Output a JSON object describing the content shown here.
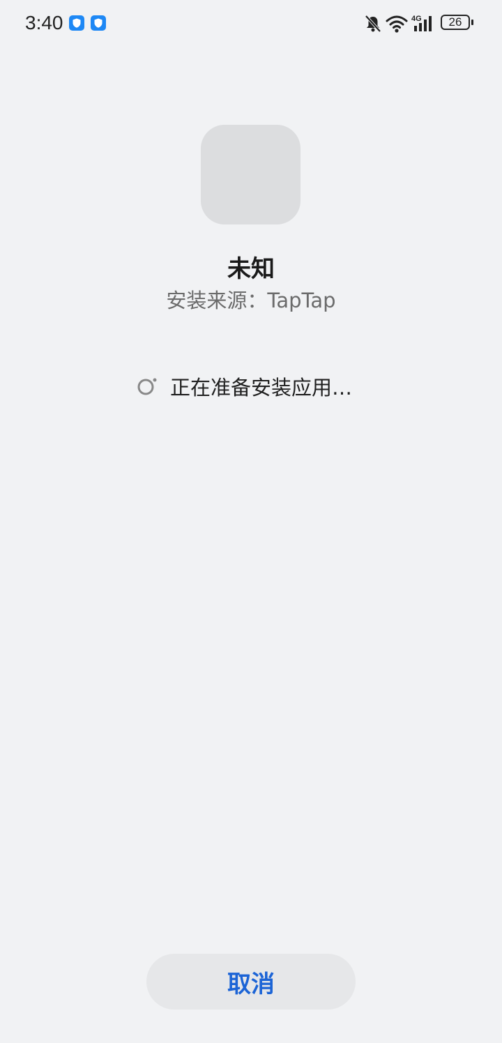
{
  "status_bar": {
    "time": "3:40",
    "battery": "26",
    "network": "4G",
    "icons": [
      "shield-icon",
      "shield-icon",
      "bell-muted-icon",
      "wifi-icon",
      "cellular-4g-icon",
      "battery-icon"
    ]
  },
  "app": {
    "name": "未知",
    "source": "安装来源：TapTap"
  },
  "progress": {
    "text": "正在准备安装应用…"
  },
  "actions": {
    "cancel_label": "取消"
  },
  "colors": {
    "background": "#f1f2f4",
    "accent": "#1c64d6",
    "shield": "#1e88f5"
  }
}
